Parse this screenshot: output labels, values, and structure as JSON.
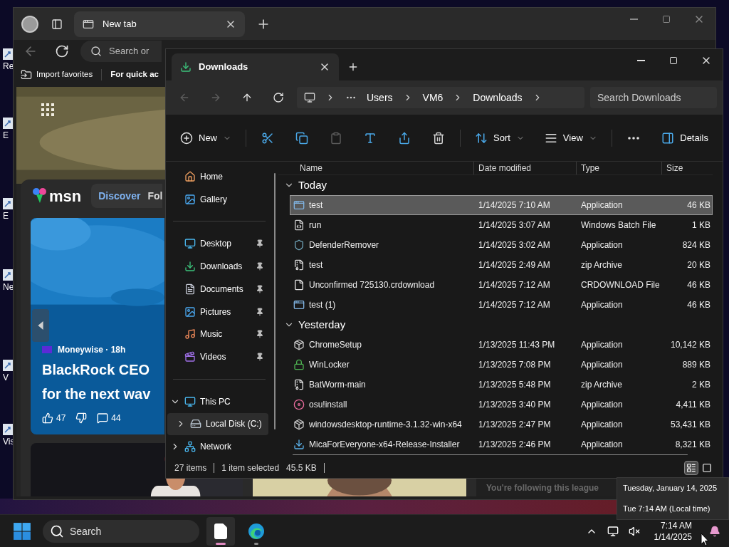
{
  "desktop_icons": [
    {
      "label": "Re"
    },
    {
      "label": "E"
    },
    {
      "label": "E"
    },
    {
      "label": "Ne"
    },
    {
      "label": "V"
    },
    {
      "label": "Vis"
    }
  ],
  "browser": {
    "tab_title": "New tab",
    "address_placeholder": "Search or",
    "favorites": [
      {
        "kind": "import",
        "label": "Import favorites"
      },
      {
        "kind": "folder",
        "label": "For quick ac"
      }
    ],
    "msn": {
      "logo": "msn",
      "tabs": [
        {
          "label": "Discover",
          "selected": true
        },
        {
          "label": "Fol",
          "selected": false
        }
      ],
      "hero": {
        "source": "Moneywise · 18h",
        "headline_lines": [
          "BlackRock CEO",
          "for the next wav"
        ],
        "likes": "47",
        "comments": "44"
      },
      "following_note": "You're following this league"
    }
  },
  "explorer": {
    "tab_title": "Downloads",
    "breadcrumb": [
      "Users",
      "VM6",
      "Downloads"
    ],
    "search_placeholder": "Search Downloads",
    "toolbar": [
      {
        "kind": "new",
        "label": "New",
        "disabled": false
      },
      {
        "kind": "cut",
        "disabled": false
      },
      {
        "kind": "copy",
        "disabled": false
      },
      {
        "kind": "paste",
        "disabled": true
      },
      {
        "kind": "rename",
        "disabled": false
      },
      {
        "kind": "share",
        "disabled": false
      },
      {
        "kind": "delete",
        "disabled": false
      },
      {
        "kind": "sort",
        "label": "Sort",
        "disabled": false
      },
      {
        "kind": "view",
        "label": "View",
        "disabled": false
      },
      {
        "kind": "more",
        "disabled": false
      },
      {
        "kind": "details",
        "label": "Details",
        "disabled": false
      }
    ],
    "nav_sections": [
      [
        {
          "kind": "home",
          "label": "Home",
          "pinned": false,
          "selected": false
        },
        {
          "kind": "gallery",
          "label": "Gallery",
          "pinned": false,
          "selected": false
        }
      ],
      [
        {
          "kind": "desktop",
          "label": "Desktop",
          "pinned": true,
          "selected": false
        },
        {
          "kind": "downloads",
          "label": "Downloads",
          "pinned": true,
          "selected": false
        },
        {
          "kind": "documents",
          "label": "Documents",
          "pinned": true,
          "selected": false
        },
        {
          "kind": "pictures",
          "label": "Pictures",
          "pinned": true,
          "selected": false
        },
        {
          "kind": "music",
          "label": "Music",
          "pinned": true,
          "selected": false
        },
        {
          "kind": "videos",
          "label": "Videos",
          "pinned": true,
          "selected": false
        }
      ],
      [
        {
          "kind": "pc",
          "label": "This PC",
          "pinned": false,
          "selected": false,
          "expanded": true,
          "children": [
            {
              "kind": "disk",
              "label": "Local Disk (C:)",
              "pinned": false,
              "selected": true,
              "expanded": false
            }
          ]
        },
        {
          "kind": "network",
          "label": "Network",
          "pinned": false,
          "selected": false,
          "expanded": false
        }
      ]
    ],
    "columns": [
      "Name",
      "Date modified",
      "Type",
      "Size"
    ],
    "groups": [
      {
        "label": "Today",
        "expanded": true,
        "rows": [
          {
            "kind": "app",
            "name": "test",
            "date": "1/14/2025 7:10 AM",
            "type": "Application",
            "size": "46 KB",
            "selected": true
          },
          {
            "kind": "batch",
            "name": "run",
            "date": "1/14/2025 3:07 AM",
            "type": "Windows Batch File",
            "size": "1 KB",
            "selected": false
          },
          {
            "kind": "shield",
            "name": "DefenderRemover",
            "date": "1/14/2025 3:02 AM",
            "type": "Application",
            "size": "824 KB",
            "selected": false
          },
          {
            "kind": "zip",
            "name": "test",
            "date": "1/14/2025 2:49 AM",
            "type": "zip Archive",
            "size": "20 KB",
            "selected": false
          },
          {
            "kind": "blank",
            "name": "Unconfirmed 725130.crdownload",
            "date": "1/14/2025 7:12 AM",
            "type": "CRDOWNLOAD File",
            "size": "46 KB",
            "selected": false
          },
          {
            "kind": "app",
            "name": "test (1)",
            "date": "1/14/2025 7:12 AM",
            "type": "Application",
            "size": "46 KB",
            "selected": false
          }
        ]
      },
      {
        "label": "Yesterday",
        "expanded": true,
        "rows": [
          {
            "kind": "setup",
            "name": "ChromeSetup",
            "date": "1/13/2025 11:43 PM",
            "type": "Application",
            "size": "10,142 KB",
            "selected": false
          },
          {
            "kind": "lock",
            "name": "WinLocker",
            "date": "1/13/2025 7:08 PM",
            "type": "Application",
            "size": "889 KB",
            "selected": false
          },
          {
            "kind": "zip",
            "name": "BatWorm-main",
            "date": "1/13/2025 5:48 PM",
            "type": "zip Archive",
            "size": "2 KB",
            "selected": false
          },
          {
            "kind": "disc",
            "name": "osu!install",
            "date": "1/13/2025 3:40 PM",
            "type": "Application",
            "size": "4,411 KB",
            "selected": false
          },
          {
            "kind": "setup",
            "name": "windowsdesktop-runtime-3.1.32-win-x64",
            "date": "1/13/2025 2:47 PM",
            "type": "Application",
            "size": "53,431 KB",
            "selected": false
          },
          {
            "kind": "installer",
            "name": "MicaForEveryone-x64-Release-Installer",
            "date": "1/13/2025 2:46 PM",
            "type": "Application",
            "size": "8,321 KB",
            "selected": false
          }
        ]
      }
    ],
    "status": {
      "count": "27 items",
      "selection": "1 item selected",
      "selection_size": "45.5 KB"
    },
    "views": [
      {
        "kind": "details",
        "selected": true
      },
      {
        "kind": "tiles",
        "selected": false
      }
    ]
  },
  "taskbar": {
    "search_placeholder": "Search",
    "apps": [
      {
        "kind": "explorer",
        "active": true
      },
      {
        "kind": "edge",
        "active": false
      }
    ],
    "volume_muted": true,
    "time": "7:14 AM",
    "date": "1/14/2025"
  },
  "clock_tooltip": {
    "lines": [
      "Tuesday, January 14, 2025",
      "Tue 7:14 AM (Local time)"
    ]
  }
}
